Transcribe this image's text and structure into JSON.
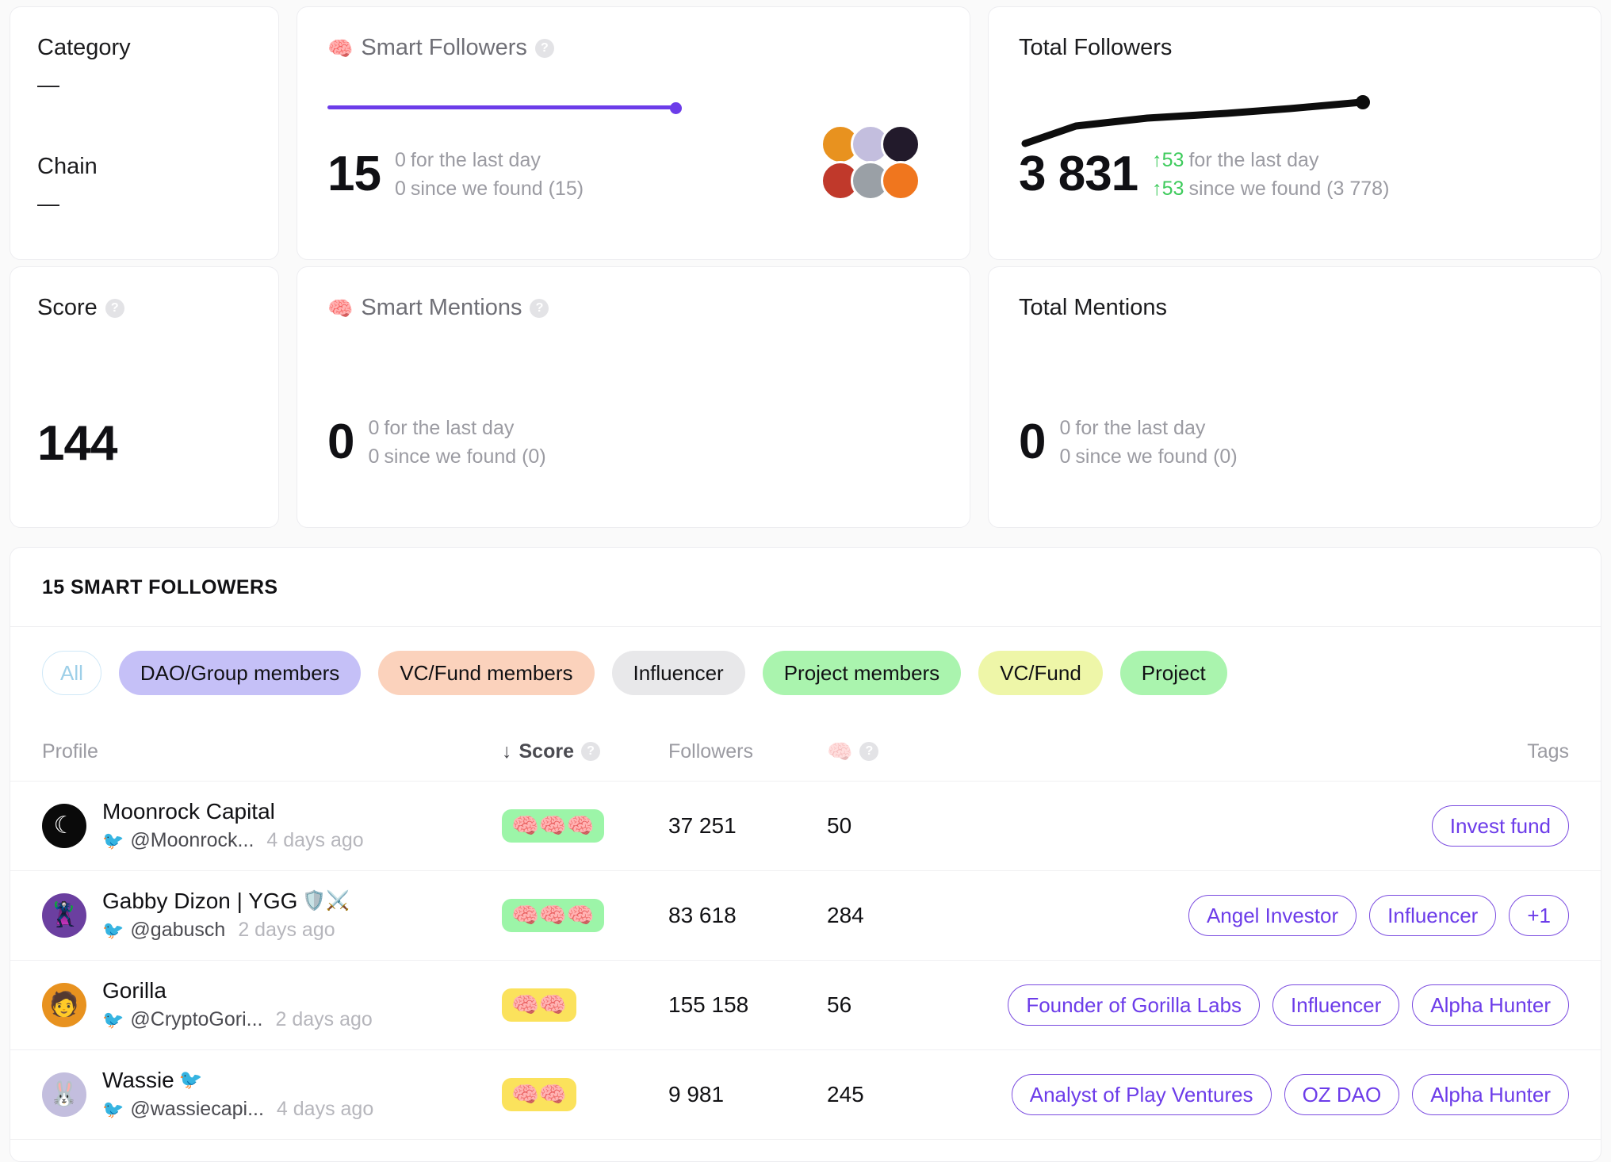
{
  "cards": {
    "category": {
      "title": "Category",
      "value": "—"
    },
    "chain": {
      "title": "Chain",
      "value": "—"
    },
    "smart_followers": {
      "title": "Smart Followers",
      "icon": "brain-icon",
      "help": "?",
      "value": "15",
      "delta_day_value": "0",
      "delta_day_label": "for the last day",
      "delta_found_value": "0",
      "delta_found_label": "since we found (15)",
      "slider_percent": 100,
      "accent": "#6c3ce9"
    },
    "total_followers": {
      "title": "Total Followers",
      "value": "3 831",
      "delta_day_value": "↑53",
      "delta_day_label": "for the last day",
      "delta_found_value": "↑53",
      "delta_found_label": "since we found (3 778)",
      "up_color": "#3ecb5c"
    },
    "score": {
      "title": "Score",
      "help": "?",
      "value": "144"
    },
    "smart_mentions": {
      "title": "Smart Mentions",
      "icon": "brain-icon",
      "help": "?",
      "value": "0",
      "delta_day_value": "0",
      "delta_day_label": "for the last day",
      "delta_found_value": "0",
      "delta_found_label": "since we found (0)"
    },
    "total_mentions": {
      "title": "Total Mentions",
      "value": "0",
      "delta_day_value": "0",
      "delta_day_label": "for the last day",
      "delta_found_value": "0",
      "delta_found_label": "since we found (0)"
    }
  },
  "chart_data": {
    "type": "line",
    "title": "Total Followers",
    "x": [
      0,
      1,
      2,
      3,
      4,
      5,
      6
    ],
    "values": [
      3778,
      3796,
      3808,
      3816,
      3822,
      3827,
      3831
    ],
    "ylim": [
      3770,
      3840
    ],
    "xlabel": "",
    "ylabel": "",
    "grid": false,
    "legend": false,
    "line_color": "#0d0d0d",
    "endpoint_marker": true
  },
  "panel": {
    "heading": "15 SMART FOLLOWERS",
    "chips": [
      {
        "label": "All",
        "style": "all"
      },
      {
        "label": "DAO/Group members",
        "bg": "#c5c0f7"
      },
      {
        "label": "VC/Fund members",
        "bg": "#fbd2bc"
      },
      {
        "label": "Influencer",
        "bg": "#e8e8ea"
      },
      {
        "label": "Project members",
        "bg": "#aaf4ae"
      },
      {
        "label": "VC/Fund",
        "bg": "#eef6a8"
      },
      {
        "label": "Project",
        "bg": "#aaf4ae"
      }
    ],
    "table": {
      "headers": {
        "profile": "Profile",
        "score": "Score",
        "score_sort": "↓",
        "score_help": "?",
        "followers": "Followers",
        "mentions_icon": "brains-icon",
        "mentions_help": "?",
        "tags": "Tags"
      },
      "rows": [
        {
          "name": "Moonrock Capital",
          "name_emoji": "",
          "handle": "@Moonrock...",
          "ago": "4 days ago",
          "brains": 3,
          "brains_color": "green",
          "followers": "37 251",
          "mentions": "50",
          "tags": [
            "Invest fund"
          ],
          "avatar_bg": "#0a0a0a",
          "avatar_glyph": "☾",
          "avatar_fg": "#ffffff"
        },
        {
          "name": "Gabby Dizon | YGG",
          "name_emoji": "🛡️⚔️",
          "handle": "@gabusch",
          "ago": "2 days ago",
          "brains": 3,
          "brains_color": "green",
          "followers": "83 618",
          "mentions": "284",
          "tags": [
            "Angel Investor",
            "Influencer",
            "+1"
          ],
          "avatar_bg": "#6b3fa0",
          "avatar_glyph": "🦹",
          "avatar_fg": "#8cff6b"
        },
        {
          "name": "Gorilla",
          "name_emoji": "",
          "handle": "@CryptoGori...",
          "ago": "2 days ago",
          "brains": 2,
          "brains_color": "yellow",
          "followers": "155 158",
          "mentions": "56",
          "tags": [
            "Founder of Gorilla Labs",
            "Influencer",
            "Alpha Hunter"
          ],
          "avatar_bg": "#e8921f",
          "avatar_glyph": "🧑",
          "avatar_fg": "#ffffff"
        },
        {
          "name": "Wassie",
          "name_emoji": "🐦",
          "handle": "@wassiecapi...",
          "ago": "4 days ago",
          "brains": 2,
          "brains_color": "yellow",
          "followers": "9 981",
          "mentions": "245",
          "tags": [
            "Analyst of Play Ventures",
            "OZ DAO",
            "Alpha Hunter"
          ],
          "avatar_bg": "#c3bede",
          "avatar_glyph": "🐰",
          "avatar_fg": "#222222"
        }
      ]
    }
  },
  "avatars": {
    "row1": [
      "#e8921f",
      "#c3bede",
      "#221a2b"
    ],
    "row2": [
      "#c0392b",
      "#9aa0a6",
      "#f0761e"
    ]
  }
}
